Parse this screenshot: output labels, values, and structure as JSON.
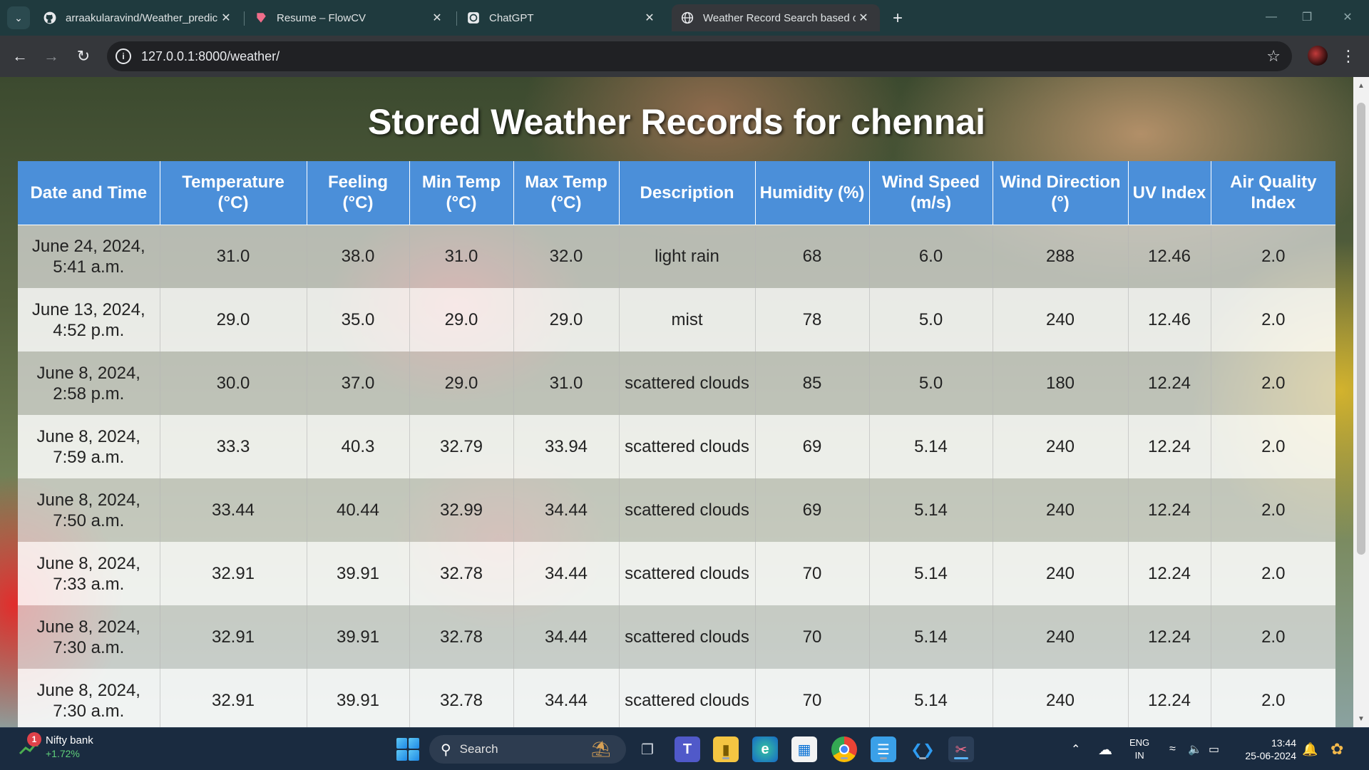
{
  "browser": {
    "tabs": [
      {
        "title": "arraakularavind/Weather_predic",
        "icon": "github-icon",
        "active": false
      },
      {
        "title": "Resume – FlowCV",
        "icon": "flowcv-icon",
        "active": false
      },
      {
        "title": "ChatGPT",
        "icon": "chatgpt-icon",
        "active": false
      },
      {
        "title": "Weather Record Search based o",
        "icon": "globe-icon",
        "active": true
      }
    ],
    "url": "127.0.0.1:8000/weather/"
  },
  "page": {
    "title": "Stored Weather Records for chennai",
    "header_color": "#4b8fd9",
    "columns": [
      "Date and Time",
      "Temperature (°C)",
      "Feeling (°C)",
      "Min Temp (°C)",
      "Max Temp (°C)",
      "Description",
      "Humidity (%)",
      "Wind Speed (m/s)",
      "Wind Direction (°)",
      "UV Index",
      "Air Quality Index"
    ],
    "rows": [
      [
        "June 24, 2024, 5:41 a.m.",
        "31.0",
        "38.0",
        "31.0",
        "32.0",
        "light rain",
        "68",
        "6.0",
        "288",
        "12.46",
        "2.0"
      ],
      [
        "June 13, 2024, 4:52 p.m.",
        "29.0",
        "35.0",
        "29.0",
        "29.0",
        "mist",
        "78",
        "5.0",
        "240",
        "12.46",
        "2.0"
      ],
      [
        "June 8, 2024, 2:58 p.m.",
        "30.0",
        "37.0",
        "29.0",
        "31.0",
        "scattered clouds",
        "85",
        "5.0",
        "180",
        "12.24",
        "2.0"
      ],
      [
        "June 8, 2024, 7:59 a.m.",
        "33.3",
        "40.3",
        "32.79",
        "33.94",
        "scattered clouds",
        "69",
        "5.14",
        "240",
        "12.24",
        "2.0"
      ],
      [
        "June 8, 2024, 7:50 a.m.",
        "33.44",
        "40.44",
        "32.99",
        "34.44",
        "scattered clouds",
        "69",
        "5.14",
        "240",
        "12.24",
        "2.0"
      ],
      [
        "June 8, 2024, 7:33 a.m.",
        "32.91",
        "39.91",
        "32.78",
        "34.44",
        "scattered clouds",
        "70",
        "5.14",
        "240",
        "12.24",
        "2.0"
      ],
      [
        "June 8, 2024, 7:30 a.m.",
        "32.91",
        "39.91",
        "32.78",
        "34.44",
        "scattered clouds",
        "70",
        "5.14",
        "240",
        "12.24",
        "2.0"
      ],
      [
        "June 8, 2024, 7:30 a.m.",
        "32.91",
        "39.91",
        "32.78",
        "34.44",
        "scattered clouds",
        "70",
        "5.14",
        "240",
        "12.24",
        "2.0"
      ]
    ]
  },
  "taskbar": {
    "widget": {
      "badge": "1",
      "name": "Nifty bank",
      "change": "+1.72%"
    },
    "search_label": "Search",
    "apps": [
      "file-explorer-task-view-icon",
      "teams-icon",
      "folder-icon",
      "edge-icon",
      "store-icon",
      "chrome-icon",
      "notepad-icon",
      "vscode-icon",
      "snipping-tool-icon"
    ],
    "language": {
      "line1": "ENG",
      "line2": "IN"
    },
    "clock": {
      "time": "13:44",
      "date": "25-06-2024"
    }
  }
}
